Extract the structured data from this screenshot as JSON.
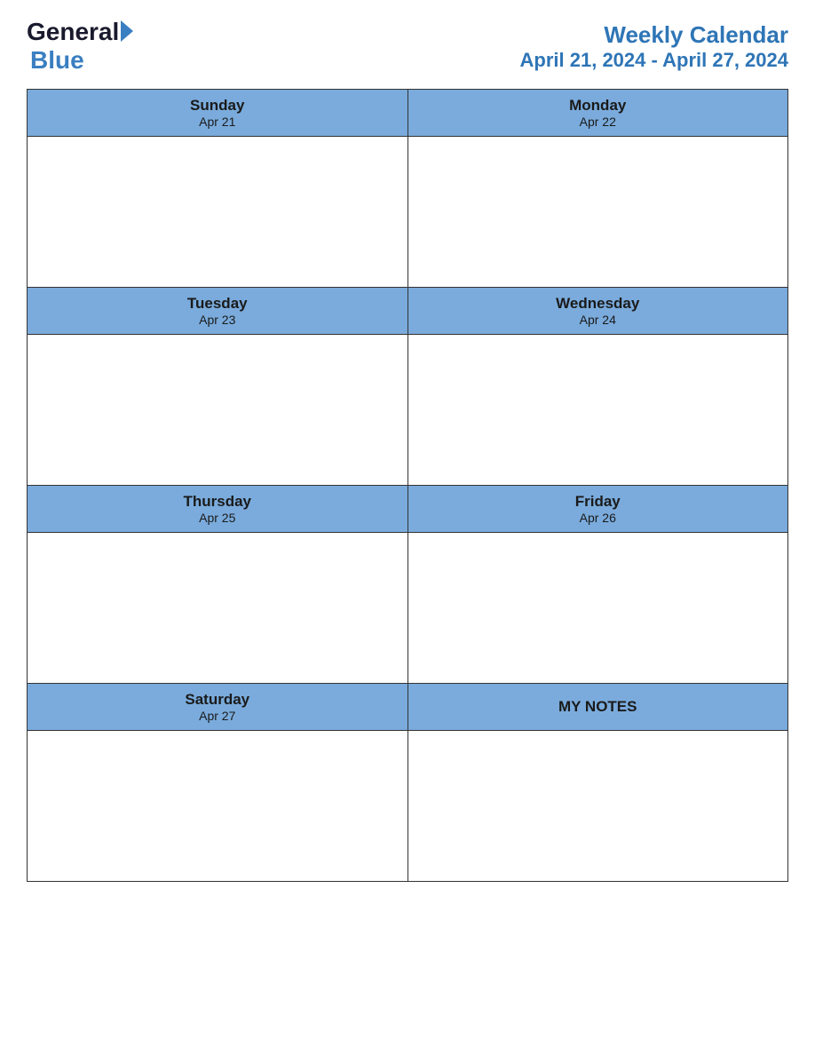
{
  "header": {
    "logo": {
      "general": "General",
      "triangle_symbol": "▶",
      "blue": "Blue"
    },
    "title": "Weekly Calendar",
    "subtitle": "April 21, 2024 - April 27, 2024"
  },
  "days": [
    {
      "name": "Sunday",
      "date": "Apr 21"
    },
    {
      "name": "Monday",
      "date": "Apr 22"
    },
    {
      "name": "Tuesday",
      "date": "Apr 23"
    },
    {
      "name": "Wednesday",
      "date": "Apr 24"
    },
    {
      "name": "Thursday",
      "date": "Apr 25"
    },
    {
      "name": "Friday",
      "date": "Apr 26"
    },
    {
      "name": "Saturday",
      "date": "Apr 27"
    }
  ],
  "notes_label": "MY NOTES"
}
